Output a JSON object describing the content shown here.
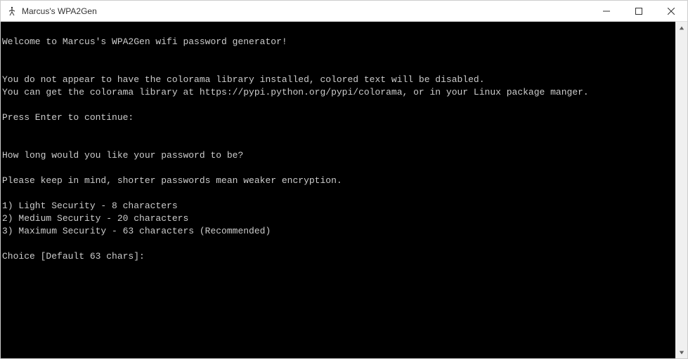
{
  "titlebar": {
    "title": "Marcus's WPA2Gen"
  },
  "console": {
    "lines": [
      "",
      "Welcome to Marcus's WPA2Gen wifi password generator!",
      "",
      "",
      "You do not appear to have the colorama library installed, colored text will be disabled.",
      "You can get the colorama library at https://pypi.python.org/pypi/colorama, or in your Linux package manger.",
      "",
      "Press Enter to continue:",
      "",
      "",
      "How long would you like your password to be?",
      "",
      "Please keep in mind, shorter passwords mean weaker encryption.",
      "",
      "1) Light Security - 8 characters",
      "2) Medium Security - 20 characters",
      "3) Maximum Security - 63 characters (Recommended)",
      "",
      "Choice [Default 63 chars]:"
    ]
  }
}
